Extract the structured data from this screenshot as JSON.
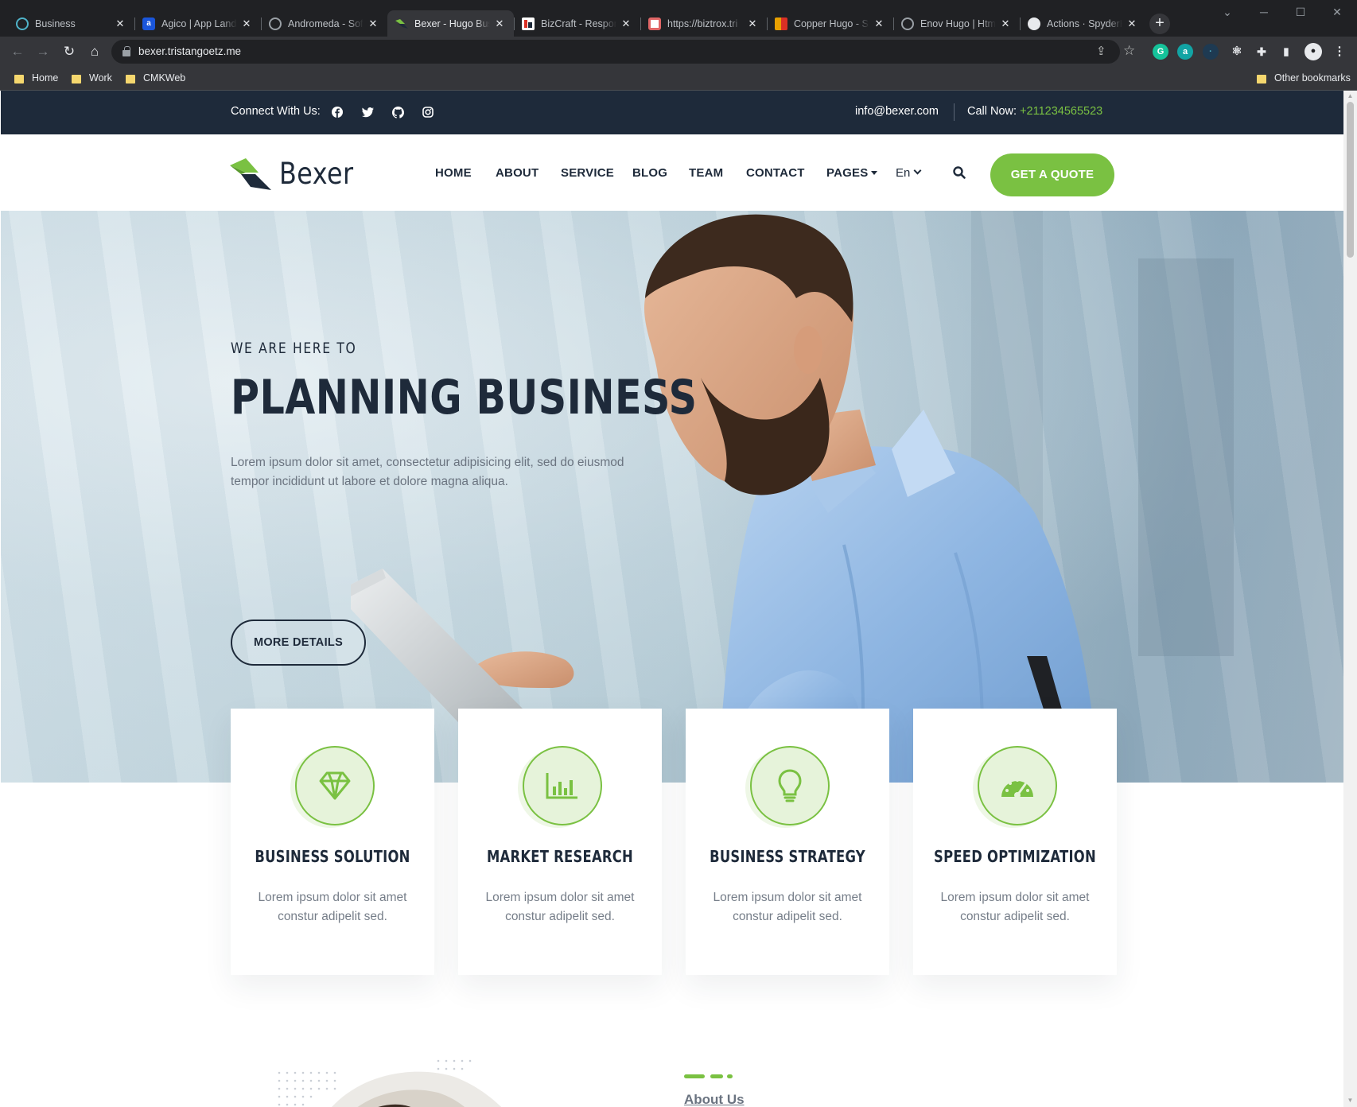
{
  "browser": {
    "tabs": [
      {
        "title": "Business",
        "favicon": "compass-icon",
        "color": "#4fb3c9"
      },
      {
        "title": "Agico | App Landi",
        "favicon": "a-logo-icon",
        "color": "#1a56db"
      },
      {
        "title": "Andromeda - Sof",
        "favicon": "globe-icon",
        "color": "#9aa0a6"
      },
      {
        "title": "Bexer - Hugo Busi",
        "favicon": "bexer-logo-icon",
        "color": "#7ac142"
      },
      {
        "title": "BizCraft - Respon",
        "favicon": "bizcraft-icon",
        "color": "#d93025"
      },
      {
        "title": "https://biztrox.tri",
        "favicon": "biztrox-icon",
        "color": "#e06666"
      },
      {
        "title": "Copper Hugo - Sr",
        "favicon": "copper-icon",
        "color": "#e8a000"
      },
      {
        "title": "Enov Hugo | Htm",
        "favicon": "globe-icon",
        "color": "#9aa0a6"
      },
      {
        "title": "Actions · SpyderH",
        "favicon": "github-icon",
        "color": "#e8eaed"
      }
    ],
    "url": "bexer.tristangoetz.me",
    "bookmarks": [
      "Home",
      "Work",
      "CMKWeb"
    ],
    "other_bookmarks": "Other bookmarks"
  },
  "topbar": {
    "connect_label": "Connect With Us:",
    "social": [
      "facebook-icon",
      "twitter-icon",
      "github-icon",
      "instagram-icon"
    ],
    "email": "info@bexer.com",
    "call_label": "Call Now:",
    "phone": "+211234565523"
  },
  "header": {
    "logo_text": "Bexer",
    "menu": [
      "HOME",
      "ABOUT",
      "SERVICE",
      "BLOG",
      "TEAM",
      "CONTACT",
      "PAGES"
    ],
    "language": "En",
    "cta": "GET A QUOTE"
  },
  "hero": {
    "eyebrow": "WE ARE HERE TO",
    "title": "PLANNING BUSINESS",
    "text": "Lorem ipsum dolor sit amet, consectetur adipisicing elit, sed do eiusmod tempor incididunt ut labore et dolore magna aliqua.",
    "button": "MORE DETAILS"
  },
  "features": [
    {
      "icon": "diamond-icon",
      "title": "BUSINESS SOLUTION",
      "text": "Lorem ipsum dolor sit amet constur adipelit sed."
    },
    {
      "icon": "bar-chart-icon",
      "title": "MARKET RESEARCH",
      "text": "Lorem ipsum dolor sit amet constur adipelit sed."
    },
    {
      "icon": "lightbulb-icon",
      "title": "BUSINESS STRATEGY",
      "text": "Lorem ipsum dolor sit amet constur adipelit sed."
    },
    {
      "icon": "speedometer-icon",
      "title": "SPEED OPTIMIZATION",
      "text": "Lorem ipsum dolor sit amet constur adipelit sed."
    }
  ],
  "about": {
    "label": "About Us"
  },
  "colors": {
    "accent": "#7ac142",
    "dark": "#1e2a3a",
    "text_muted": "#767e89"
  }
}
